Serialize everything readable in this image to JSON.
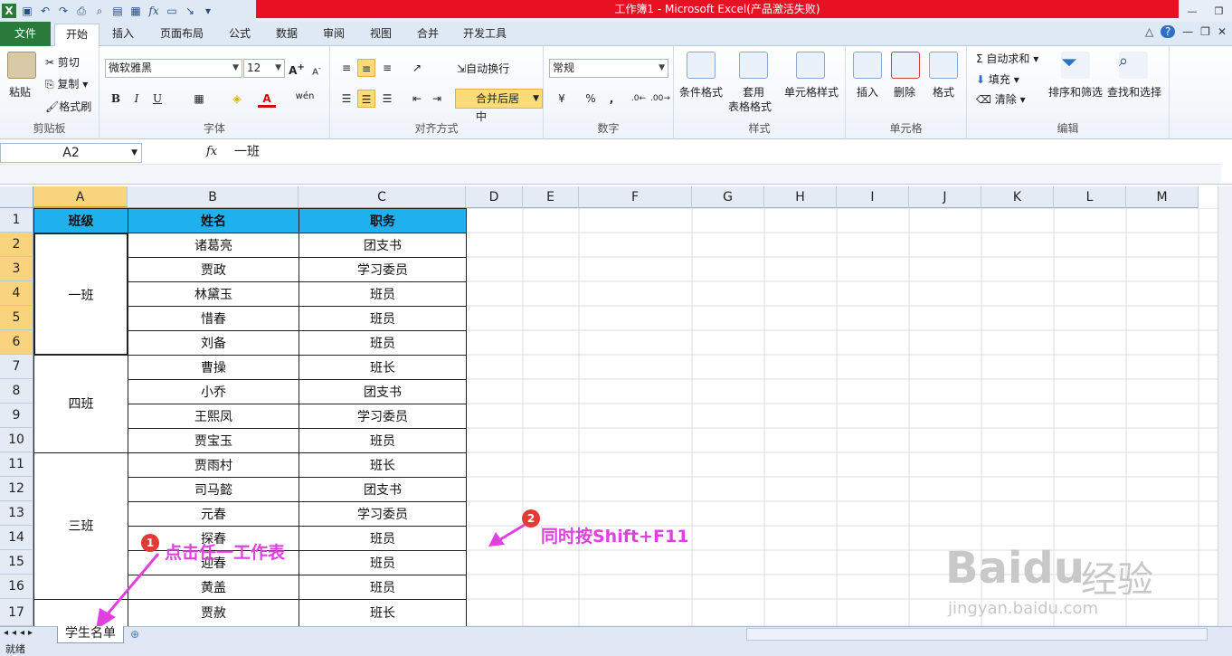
{
  "window": {
    "title": "工作簿1 - Microsoft Excel(产品激活失败)",
    "file_tab": "文件",
    "tabs": [
      "开始",
      "插入",
      "页面布局",
      "公式",
      "数据",
      "审阅",
      "视图",
      "合并",
      "开发工具"
    ],
    "active_tab": "开始"
  },
  "ribbon": {
    "clipboard": {
      "paste": "粘贴",
      "cut": "剪切",
      "copy": "复制",
      "format_painter": "格式刷",
      "label": "剪贴板"
    },
    "font": {
      "name": "微软雅黑",
      "size": "12",
      "label": "字体",
      "bold": "B",
      "italic": "I",
      "underline": "U",
      "font_color_letter": "A",
      "wen": "wén"
    },
    "alignment": {
      "wrap": "自动换行",
      "merge": "合并后居中",
      "label": "对齐方式"
    },
    "number": {
      "format": "常规",
      "percent": "%",
      "comma": ",",
      "label": "数字"
    },
    "styles": {
      "conditional": "条件格式",
      "table_format_1": "套用",
      "table_format_2": "表格格式",
      "cell_styles": "单元格样式",
      "label": "样式"
    },
    "cells": {
      "insert": "插入",
      "delete": "删除",
      "format": "格式",
      "label": "单元格"
    },
    "editing": {
      "autosum": "自动求和",
      "fill": "填充",
      "clear": "清除",
      "sort": "排序和筛选",
      "find": "查找和选择",
      "label": "编辑"
    }
  },
  "formula_bar": {
    "name_box": "A2",
    "fx": "fx",
    "content": "一班"
  },
  "columns": [
    "A",
    "B",
    "C",
    "D",
    "E",
    "F",
    "G",
    "H",
    "I",
    "J",
    "K",
    "L",
    "M"
  ],
  "rows": [
    "1",
    "2",
    "3",
    "4",
    "5",
    "6",
    "7",
    "8",
    "9",
    "10",
    "11",
    "12",
    "13",
    "14",
    "15",
    "16",
    "17"
  ],
  "table": {
    "headers": [
      "班级",
      "姓名",
      "职务"
    ],
    "classes": [
      "一班",
      "四班",
      "三班"
    ],
    "names": [
      "诸葛亮",
      "贾政",
      "林黛玉",
      "惜春",
      "刘备",
      "曹操",
      "小乔",
      "王熙凤",
      "贾宝玉",
      "贾雨村",
      "司马懿",
      "元春",
      "探春",
      "迎春",
      "黄盖",
      "贾赦"
    ],
    "roles": [
      "团支书",
      "学习委员",
      "班员",
      "班员",
      "班员",
      "班长",
      "团支书",
      "学习委员",
      "班员",
      "班长",
      "团支书",
      "学习委员",
      "班员",
      "班员",
      "班员",
      "班长"
    ]
  },
  "sheet_tabs": [
    "学生名单"
  ],
  "status": "就绪",
  "annotations": {
    "step1_num": "1",
    "step1_text": "点击任一工作表",
    "step2_num": "2",
    "step2_text": "同时按Shift+F11"
  },
  "watermark": {
    "logo": "Baidu",
    "jingyan": "经验",
    "url": "jingyan.baidu.com"
  },
  "colors": {
    "header_fill": "#1fb0ee",
    "title_red": "#e81123",
    "annotation": "#e040e0",
    "file_tab": "#2a7a3b"
  }
}
